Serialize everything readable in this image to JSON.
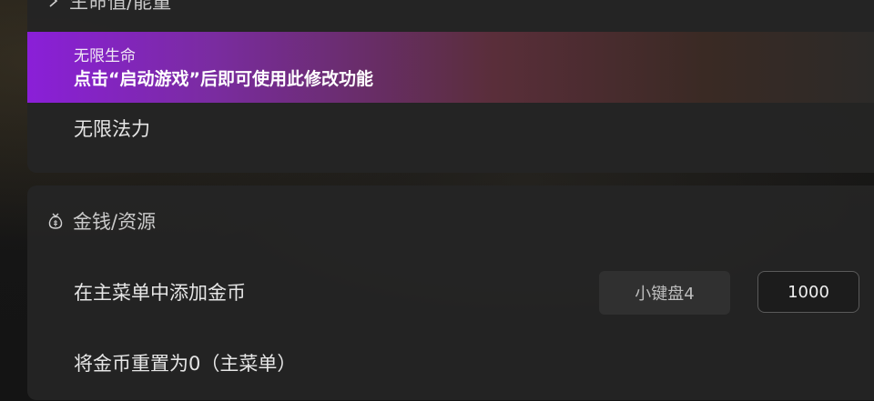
{
  "health_section": {
    "header_label": "生命值/能量",
    "icon": "heart-icon",
    "items": [
      {
        "label": "无限生命",
        "hint": "点击“启动游戏”后即可使用此修改功能",
        "state": "highlighted"
      },
      {
        "label": "无限法力"
      }
    ]
  },
  "money_section": {
    "header_label": "金钱/资源",
    "icon": "money-bag-icon",
    "items": [
      {
        "label": "在主菜单中添加金币",
        "hotkey": "小键盘4",
        "value": "1000"
      },
      {
        "label": "将金币重置为0（主菜单）"
      }
    ]
  },
  "colors": {
    "highlight_start": "#8a1fd8",
    "card_bg": "#242424",
    "text": "#e6e6e6"
  }
}
